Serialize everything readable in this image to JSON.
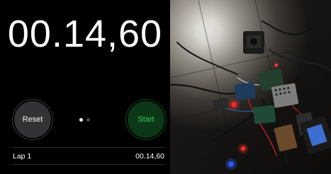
{
  "stopwatch": {
    "time": "00.14,60",
    "reset_label": "Reset",
    "start_label": "Start",
    "page_indicator": {
      "pages": 2,
      "active": 1
    },
    "laps": [
      {
        "label": "Lap 1",
        "time": "00.14,60"
      }
    ]
  },
  "colors": {
    "background": "#000000",
    "start_green": "#30d158",
    "start_bg": "#0c3817",
    "reset_bg": "#333335"
  },
  "photo": {
    "icon": "photo-of-circuit-boards-and-wires"
  }
}
